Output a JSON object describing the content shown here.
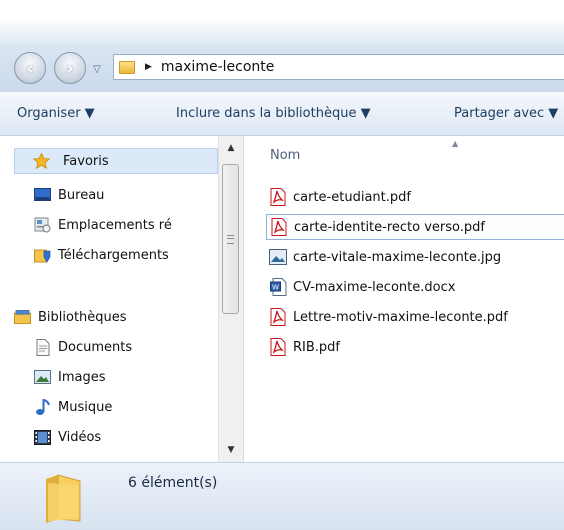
{
  "address": {
    "path": "maxime-leconte"
  },
  "toolbar": {
    "organiser": "Organiser ▼",
    "inclure": "Inclure dans la bibliothèque ▼",
    "partager": "Partager avec ▼"
  },
  "nav": {
    "favoris": "Favoris",
    "bureau": "Bureau",
    "emplacements": "Emplacements ré",
    "telechargements": "Téléchargements",
    "bibliotheques": "Bibliothèques",
    "documents": "Documents",
    "images": "Images",
    "musique": "Musique",
    "videos": "Vidéos"
  },
  "content": {
    "column_header": "Nom",
    "files": [
      {
        "name": "carte-etudiant.pdf",
        "icon": "pdf-icon"
      },
      {
        "name": "carte-identite-recto verso.pdf",
        "icon": "pdf-icon"
      },
      {
        "name": "carte-vitale-maxime-leconte.jpg",
        "icon": "image-file-icon"
      },
      {
        "name": "CV-maxime-leconte.docx",
        "icon": "word-doc-icon"
      },
      {
        "name": "Lettre-motiv-maxime-leconte.pdf",
        "icon": "pdf-icon"
      },
      {
        "name": "RIB.pdf",
        "icon": "pdf-icon"
      }
    ]
  },
  "status": {
    "count": "6 élément(s)"
  },
  "colors": {
    "accent": "#1e3e63",
    "selection": "#dbe9f8",
    "pdf_red": "#c8161d"
  }
}
